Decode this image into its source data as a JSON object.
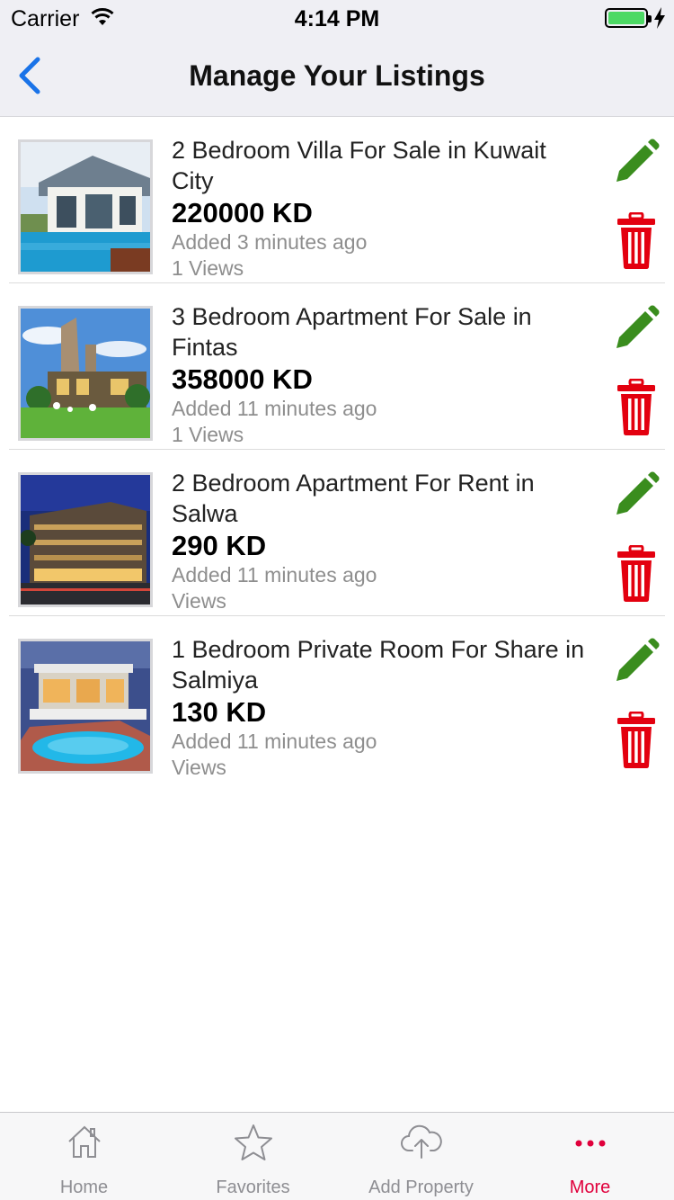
{
  "status": {
    "carrier": "Carrier",
    "time": "4:14 PM"
  },
  "nav": {
    "title": "Manage Your Listings"
  },
  "listings": [
    {
      "title": "2 Bedroom Villa For Sale in Kuwait City",
      "price": "220000 KD",
      "added": "Added 3 minutes ago",
      "views": "1 Views"
    },
    {
      "title": "3 Bedroom Apartment For Sale in Fintas",
      "price": "358000 KD",
      "added": "Added 11 minutes ago",
      "views": "1 Views"
    },
    {
      "title": "2 Bedroom Apartment For Rent in Salwa",
      "price": "290 KD",
      "added": "Added 11 minutes ago",
      "views": " Views"
    },
    {
      "title": "1 Bedroom Private Room For Share in Salmiya",
      "price": "130 KD",
      "added": "Added 11 minutes ago",
      "views": " Views"
    }
  ],
  "tabs": [
    {
      "label": "Home",
      "icon": "home-icon"
    },
    {
      "label": "Favorites",
      "icon": "star-icon"
    },
    {
      "label": "Add Property",
      "icon": "cloud-upload-icon"
    },
    {
      "label": "More",
      "icon": "more-icon"
    }
  ],
  "colors": {
    "accent": "#e0003c",
    "edit": "#3a8d1e",
    "delete": "#e3000f",
    "back": "#1a73e8"
  }
}
